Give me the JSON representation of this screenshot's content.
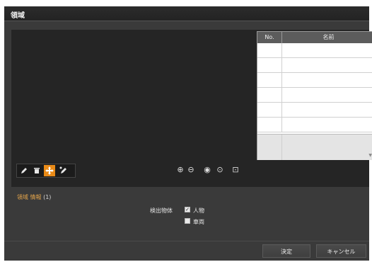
{
  "window": {
    "title": "領域"
  },
  "region_table": {
    "headers": {
      "no": "No.",
      "name": "名前"
    },
    "rows": 7
  },
  "toolbar": {
    "tools": [
      {
        "icon": "pencil-icon"
      },
      {
        "icon": "trash-icon"
      },
      {
        "icon": "move-icon",
        "active": true
      },
      {
        "icon": "edit-vertex-icon"
      }
    ],
    "zoom": [
      {
        "icon": "zoom-in-icon",
        "glyph": "⊕"
      },
      {
        "icon": "zoom-out-icon",
        "glyph": "⊖"
      },
      {
        "icon": "zoom-fit-icon",
        "glyph": "◉"
      },
      {
        "icon": "target-icon",
        "glyph": "⊙"
      },
      {
        "icon": "fullscreen-icon",
        "glyph": "⊡"
      }
    ]
  },
  "info": {
    "title": "領域 情報",
    "count": "(1)",
    "detection_label": "検出物体",
    "person": {
      "label": "人物",
      "checked": true
    },
    "vehicle": {
      "label": "車両",
      "checked": false
    }
  },
  "buttons": {
    "ok": "決定",
    "cancel": "キャンセル"
  },
  "colors": {
    "accent": "#e98a17",
    "info_title": "#e0a24a"
  }
}
